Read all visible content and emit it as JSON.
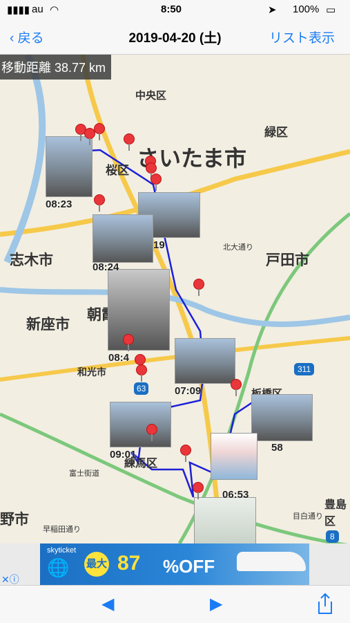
{
  "status": {
    "carrier": "au",
    "time": "8:50",
    "battery": "100%"
  },
  "nav": {
    "back_label": "戻る",
    "title": "2019-04-20 (土)",
    "list_label": "リスト表示"
  },
  "map": {
    "distance": "移動距離 38.77 km",
    "labels": [
      "中央区",
      "さいたま市",
      "緑区",
      "桜区",
      "志木市",
      "戸田市",
      "新座市",
      "朝霞",
      "和光市",
      "板橋区",
      "練馬区",
      "豊島区",
      "北大通り",
      "富士街道",
      "目白通り",
      "早稲田通り",
      "野市"
    ],
    "route_shields": [
      "311",
      "63",
      "8"
    ],
    "timestamps": [
      "08:23",
      "08:24",
      "08:4",
      "07:09",
      "09:01",
      "06:53",
      "58",
      "19"
    ]
  },
  "ad": {
    "brand": "skyticket",
    "badge": "最大",
    "percent": "87",
    "off_text": "%OFF"
  },
  "toolbar": {
    "prev": "◀",
    "next": "▶"
  },
  "colors": {
    "accent": "#1a7cf5",
    "route": "#1c1fd6",
    "pin": "#e8363b"
  }
}
